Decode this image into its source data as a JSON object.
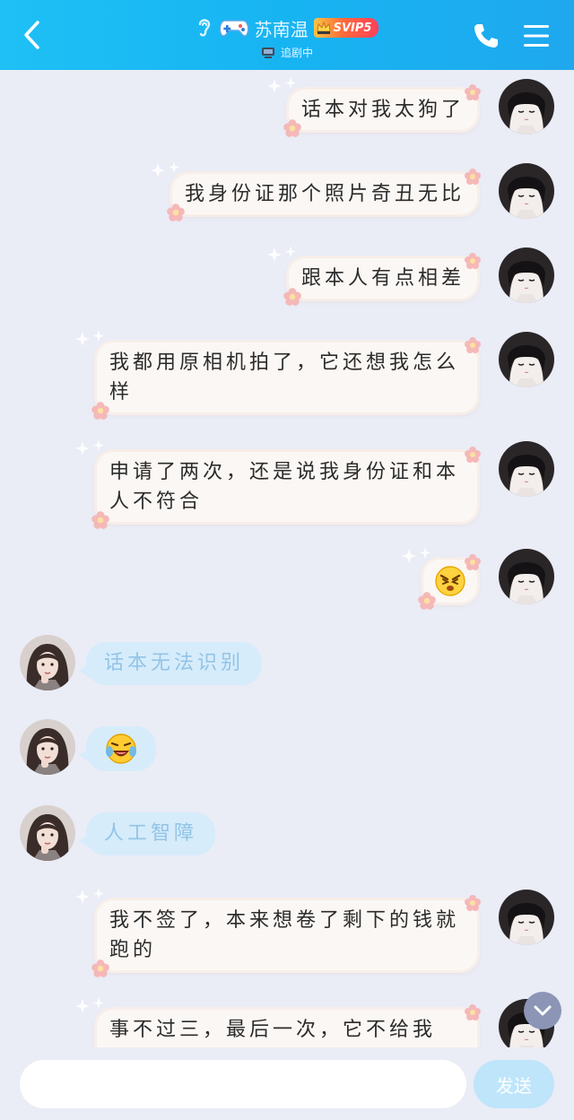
{
  "header": {
    "contact_name": "苏南温",
    "vip_label": "SVIP5",
    "status_text": "追剧中",
    "icons": [
      "back-icon",
      "ear-icon",
      "gamepad-icon",
      "tv-icon",
      "phone-icon",
      "menu-icon"
    ]
  },
  "messages": [
    {
      "side": "me",
      "text": "话本对我太狗了"
    },
    {
      "side": "me",
      "text": "我身份证那个照片奇丑无比"
    },
    {
      "side": "me",
      "text": "跟本人有点相差"
    },
    {
      "side": "me",
      "text": "我都用原相机拍了，它还想我怎么样"
    },
    {
      "side": "me",
      "text": "申请了两次，还是说我身份证和本人不符合"
    },
    {
      "side": "me",
      "emoji": "angry-face-emoji"
    },
    {
      "side": "them",
      "text": "话本无法识别"
    },
    {
      "side": "them",
      "emoji": "laugh-cry-emoji"
    },
    {
      "side": "them",
      "text": "人工智障"
    },
    {
      "side": "me",
      "text": "我不签了，本来想卷了剩下的钱就跑的"
    },
    {
      "side": "me",
      "text": "事不过三，最后一次，它不给我"
    }
  ],
  "input": {
    "placeholder": "",
    "send_label": "发送"
  },
  "colors": {
    "header_start": "#1ec0f5",
    "header_end": "#1fa8ee",
    "background": "#eaecf6",
    "my_bubble": "#fbf7f4",
    "their_bubble": "#d6ecfb",
    "send_button": "#bfe5fb"
  }
}
